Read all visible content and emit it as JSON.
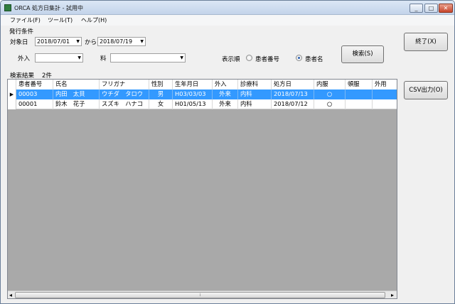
{
  "window": {
    "title": "ORCA 処方日集計 - 試用中",
    "min_btn": "_",
    "max_btn": "□",
    "close_btn": "✕"
  },
  "menu": [
    "ファイル(F)",
    "ツール(T)",
    "ヘルプ(H)"
  ],
  "conditions": {
    "group_label": "発行条件",
    "date_label": "対象日",
    "date_from": "2018/07/01",
    "date_sep": "から",
    "date_to": "2018/07/19",
    "inout_label": "外入",
    "inout_value": "",
    "dept_label": "料",
    "dept_value": "",
    "sort_label": "表示順",
    "sort_options": [
      "患者番号",
      "患者名"
    ],
    "sort_selected": "患者名"
  },
  "buttons": {
    "search": "検索(S)",
    "exit": "終了(X)",
    "csv": "CSV出力(O)"
  },
  "results": {
    "label": "検索結果",
    "count": "2件",
    "columns": [
      "患者番号",
      "氏名",
      "フリガナ",
      "性別",
      "生年月日",
      "外入",
      "診療科",
      "処方日",
      "内服",
      "頓服",
      "外用"
    ],
    "rows": [
      [
        "00003",
        "内田　太貝",
        "ウチダ　タロウ",
        "男",
        "H03/03/03",
        "外来",
        "内科",
        "2018/07/13",
        "○",
        "",
        ""
      ],
      [
        "00001",
        "鈴木　花子",
        "スズキ　ハナコ",
        "女",
        "H01/05/13",
        "外来",
        "内科",
        "2018/07/12",
        "○",
        "",
        ""
      ]
    ],
    "selected_row": 0
  },
  "scrollbar": {
    "left": "◂",
    "right": "▸",
    "grip": "⁞"
  }
}
